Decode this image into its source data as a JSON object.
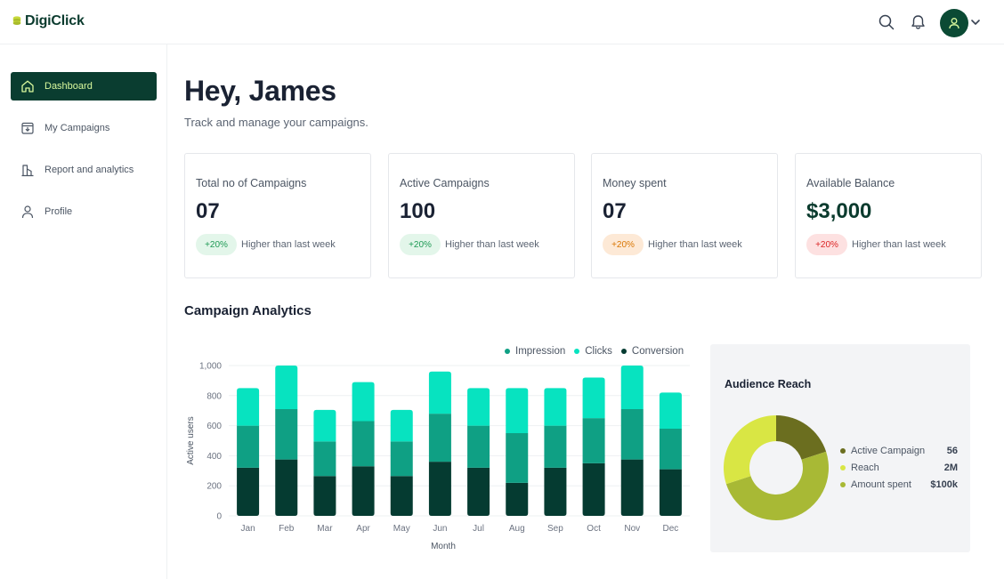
{
  "app": {
    "name": "DigiClick"
  },
  "header": {
    "icons": [
      "search-icon",
      "bell-icon",
      "user-icon",
      "chevron-down-icon"
    ]
  },
  "sidebar": {
    "items": [
      {
        "label": "Dashboard",
        "icon": "home-icon",
        "active": true
      },
      {
        "label": "My Campaigns",
        "icon": "inbox-icon",
        "active": false
      },
      {
        "label": "Report and analytics",
        "icon": "chart-icon",
        "active": false
      },
      {
        "label": "Profile",
        "icon": "user-icon",
        "active": false
      }
    ]
  },
  "main": {
    "greeting": "Hey, James",
    "subtitle": "Track and manage your campaigns.",
    "cards": [
      {
        "title": "Total no of Campaigns",
        "value": "07",
        "change": "+20%",
        "note": "Higher than last week",
        "tone": "green"
      },
      {
        "title": "Active Campaigns",
        "value": "100",
        "change": "+20%",
        "note": "Higher than last week",
        "tone": "green"
      },
      {
        "title": "Money spent",
        "value": "07",
        "change": "+20%",
        "note": "Higher than last week",
        "tone": "orange"
      },
      {
        "title": "Available Balance",
        "value": "$3,000",
        "change": "+20%",
        "note": "Higher than last week",
        "tone": "red"
      }
    ],
    "analytics_title": "Campaign Analytics"
  },
  "colors": {
    "brand": "#0a3d30",
    "impression": "#0fa084",
    "clicks": "#07e3c0",
    "conversion": "#053b31",
    "donut_active": "#6b6e1f",
    "donut_reach": "#d9e644",
    "donut_spent": "#a8b935"
  },
  "chart_data": [
    {
      "type": "bar",
      "stacked": true,
      "categories": [
        "Jan",
        "Feb",
        "Mar",
        "Apr",
        "May",
        "Jun",
        "Jul",
        "Aug",
        "Sep",
        "Oct",
        "Nov",
        "Dec"
      ],
      "series": [
        {
          "name": "Conversion",
          "values": [
            320,
            375,
            265,
            330,
            265,
            360,
            320,
            220,
            320,
            350,
            375,
            310
          ]
        },
        {
          "name": "Impression",
          "values": [
            280,
            335,
            230,
            300,
            230,
            320,
            280,
            330,
            280,
            300,
            335,
            270
          ]
        },
        {
          "name": "Clicks",
          "values": [
            250,
            290,
            210,
            260,
            210,
            280,
            250,
            300,
            250,
            270,
            290,
            240
          ]
        }
      ],
      "xlabel": "Month",
      "ylabel": "Active users",
      "yticks": [
        "0",
        "200",
        "400",
        "600",
        "800",
        "1,000"
      ],
      "ylim": [
        0,
        1000
      ],
      "legend": [
        "Impression",
        "Clicks",
        "Conversion"
      ],
      "legend_position": "top-right",
      "grid": true
    },
    {
      "type": "pie",
      "title": "Audience Reach",
      "donut": true,
      "slices": [
        {
          "name": "Active Campaign",
          "display": "56",
          "share": 0.2
        },
        {
          "name": "Reach",
          "display": "2M",
          "share": 0.3
        },
        {
          "name": "Amount spent",
          "display": "$100k",
          "share": 0.5
        }
      ]
    }
  ]
}
